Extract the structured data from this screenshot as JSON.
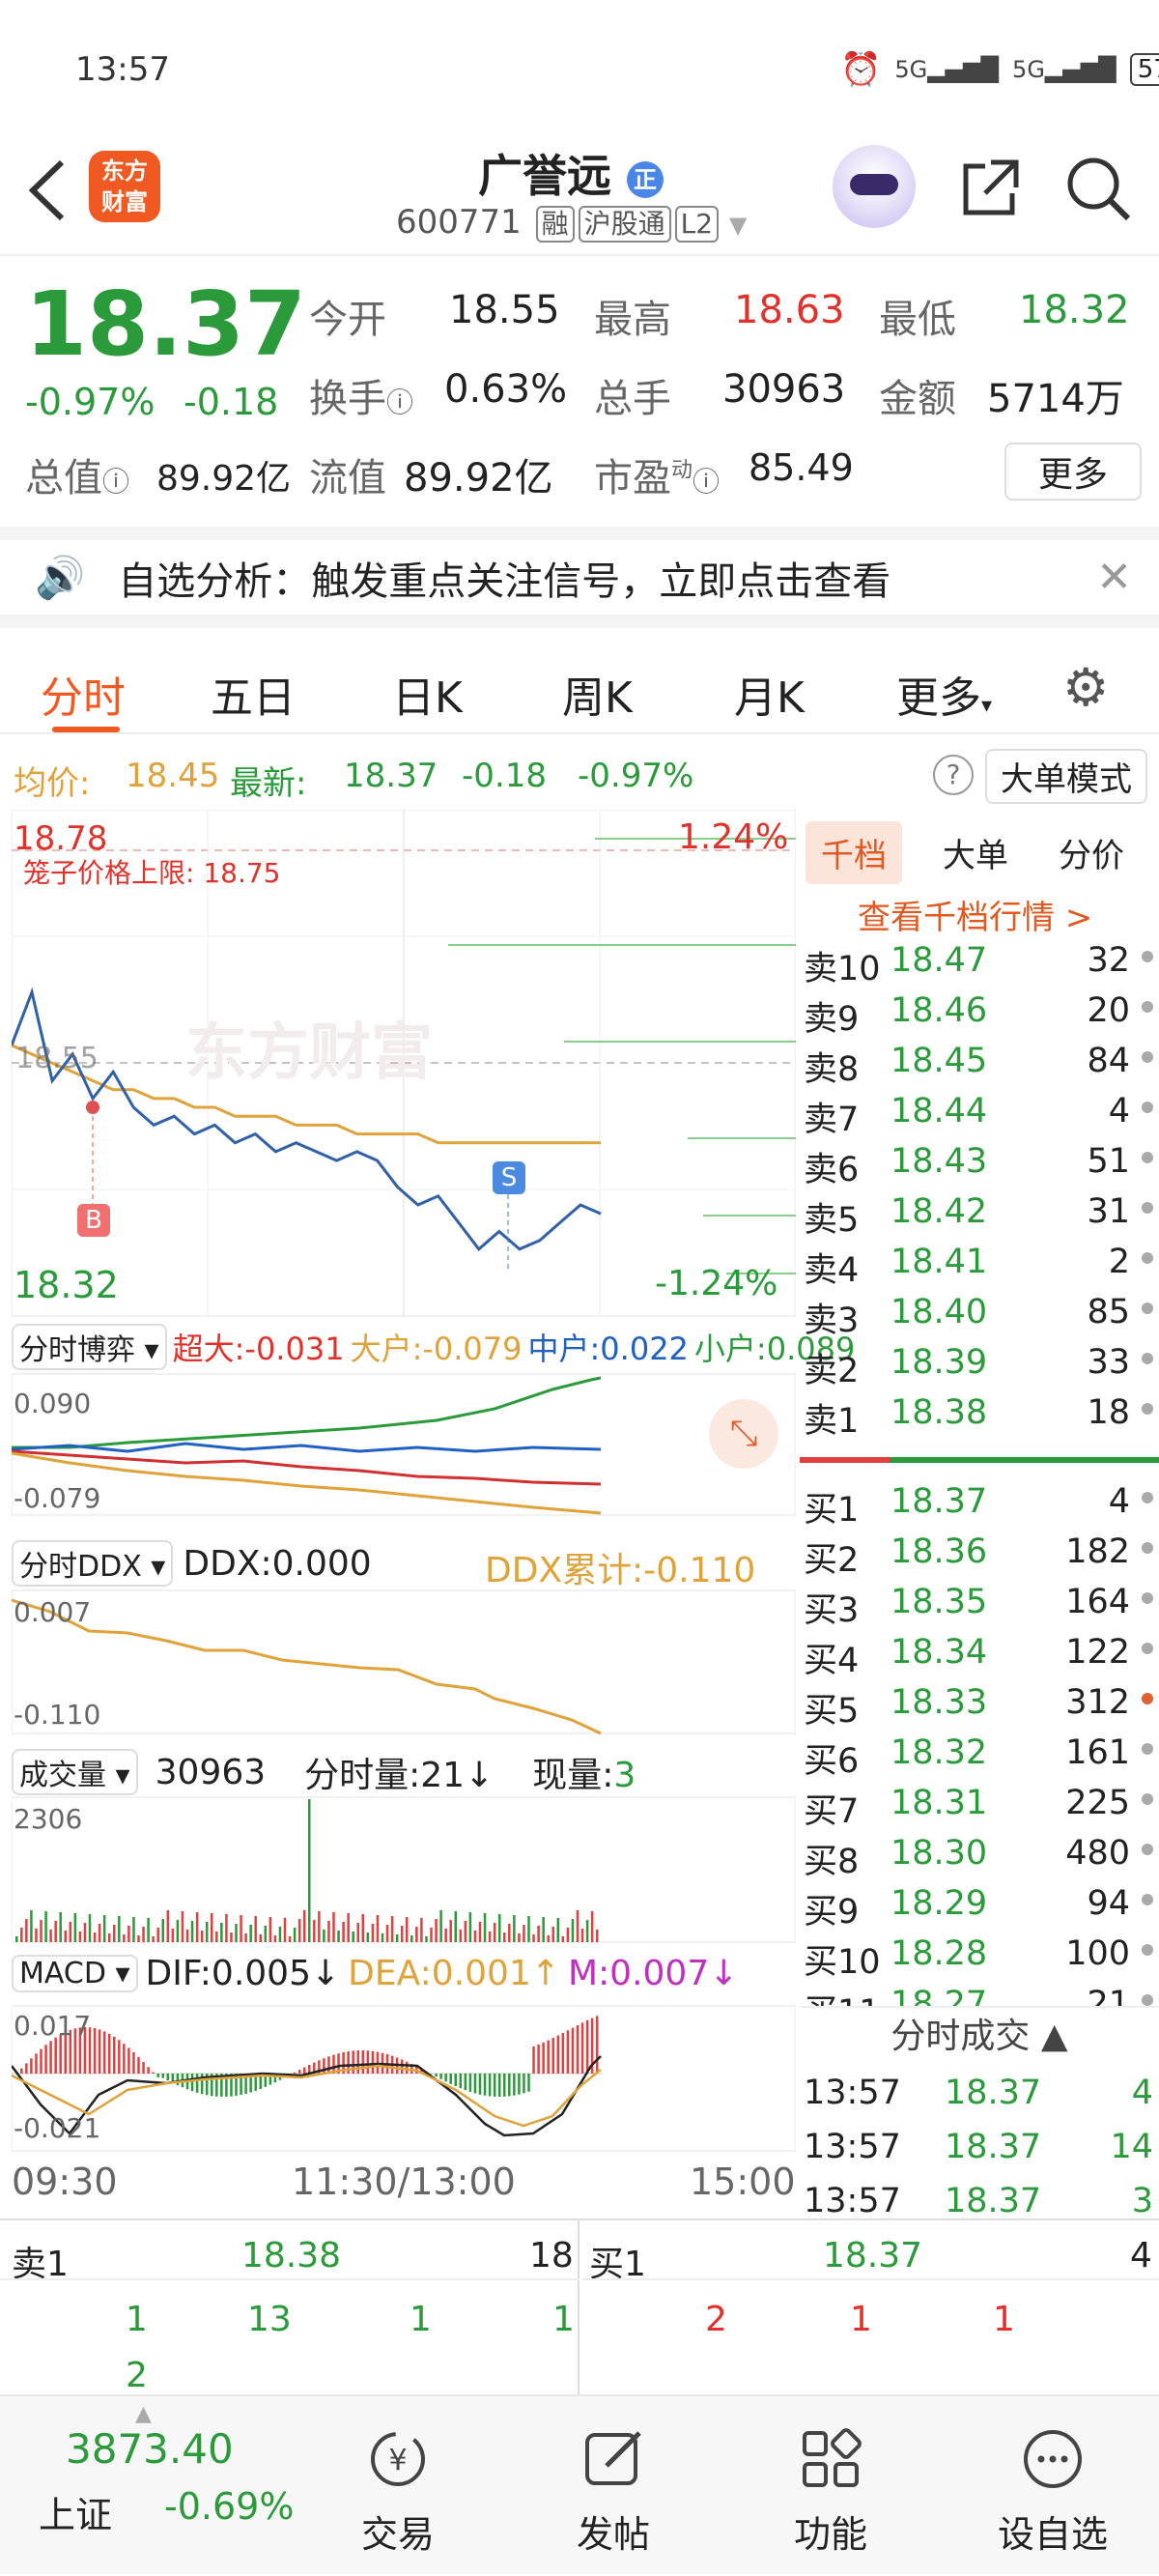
{
  "status": {
    "time": "13:57",
    "battery": "57"
  },
  "header": {
    "title": "广誉远",
    "badge": "正",
    "code": "600771",
    "tags": [
      "融",
      "沪股通",
      "L2"
    ],
    "logo_text_1": "东方",
    "logo_text_2": "财富"
  },
  "quote": {
    "price": "18.37",
    "change_pct": "-0.97%",
    "change": "-0.18",
    "open_label": "今开",
    "open": "18.55",
    "high_label": "最高",
    "high": "18.63",
    "low_label": "最低",
    "low": "18.32",
    "turnover_label": "换手",
    "turnover": "0.63%",
    "volume_label": "总手",
    "volume": "30963",
    "amount_label": "金额",
    "amount": "5714万",
    "mcap_label": "总值",
    "mcap": "89.92亿",
    "float_label": "流值",
    "float_mcap": "89.92亿",
    "pe_label": "市盈",
    "pe_sup": "动",
    "pe": "85.49",
    "more": "更多"
  },
  "notice": {
    "text": "自选分析：触发重点关注信号，立即点击查看"
  },
  "tabs": [
    "分时",
    "五日",
    "日K",
    "周K",
    "月K",
    "更多"
  ],
  "avg_line": {
    "avg_label": "均价:",
    "avg": "18.45",
    "latest_label": "最新:",
    "latest": "18.37",
    "chg": "-0.18",
    "pct": "-0.97%",
    "mode_button": "大单模式"
  },
  "chart": {
    "top_price": "18.78",
    "top_pct": "1.24%",
    "limit_label": "笼子价格上限: 18.75",
    "prev_close": "18.55",
    "bottom_price": "18.32",
    "bottom_pct": "-1.24%",
    "watermark": "东方财富",
    "buy_mark": "B",
    "sell_mark": "S",
    "flow_selector": "分时博弈",
    "flow_super": "超大:-0.031",
    "flow_big": "大户:-0.079",
    "flow_mid": "中户:0.022",
    "flow_small": "小户:0.089",
    "flow_max": "0.090",
    "flow_min": "-0.079",
    "ddx_selector": "分时DDX",
    "ddx": "DDX:0.000",
    "ddx_cum": "DDX累计:-0.110",
    "ddx_max": "0.007",
    "ddx_min": "-0.110",
    "vol_selector": "成交量",
    "vol_total": "30963",
    "vol_min_label": "分时量:21↓",
    "vol_now_label": "现量:",
    "vol_now": "3",
    "vol_max": "2306",
    "macd_selector": "MACD",
    "dif": "DIF:0.005↓",
    "dea": "DEA:0.001↑",
    "m": "M:0.007↓",
    "macd_max": "0.017",
    "macd_min": "-0.021",
    "time_start": "09:30",
    "time_mid": "11:30/13:00",
    "time_end": "15:00"
  },
  "chart_data": {
    "type": "line",
    "x_labels": [
      "09:30",
      "11:30/13:00",
      "15:00"
    ],
    "ylim": [
      18.32,
      18.78
    ],
    "prev_close": 18.55,
    "series": [
      {
        "name": "price",
        "values": [
          18.56,
          18.62,
          18.52,
          18.55,
          18.5,
          18.53,
          18.49,
          18.47,
          18.48,
          18.46,
          18.47,
          18.45,
          18.46,
          18.44,
          18.45,
          18.44,
          18.43,
          18.44,
          18.43,
          18.4,
          18.38,
          18.39,
          18.36,
          18.33,
          18.35,
          18.33,
          18.34,
          18.36,
          18.38,
          18.37
        ]
      },
      {
        "name": "avg",
        "values": [
          18.56,
          18.55,
          18.54,
          18.53,
          18.52,
          18.51,
          18.51,
          18.5,
          18.5,
          18.49,
          18.49,
          18.48,
          18.48,
          18.48,
          18.47,
          18.47,
          18.47,
          18.46,
          18.46,
          18.46,
          18.46,
          18.45,
          18.45,
          18.45,
          18.45,
          18.45,
          18.45,
          18.45,
          18.45,
          18.45
        ]
      }
    ]
  },
  "depth": {
    "tabs": [
      "千档",
      "大单",
      "分价"
    ],
    "link": "查看千档行情 >",
    "asks": [
      [
        "卖10",
        "18.47",
        "32"
      ],
      [
        "卖9",
        "18.46",
        "20"
      ],
      [
        "卖8",
        "18.45",
        "84"
      ],
      [
        "卖7",
        "18.44",
        "4"
      ],
      [
        "卖6",
        "18.43",
        "51"
      ],
      [
        "卖5",
        "18.42",
        "31"
      ],
      [
        "卖4",
        "18.41",
        "2"
      ],
      [
        "卖3",
        "18.40",
        "85"
      ],
      [
        "卖2",
        "18.39",
        "33"
      ],
      [
        "卖1",
        "18.38",
        "18"
      ]
    ],
    "bids": [
      [
        "买1",
        "18.37",
        "4"
      ],
      [
        "买2",
        "18.36",
        "182"
      ],
      [
        "买3",
        "18.35",
        "164"
      ],
      [
        "买4",
        "18.34",
        "122"
      ],
      [
        "买5",
        "18.33",
        "312"
      ],
      [
        "买6",
        "18.32",
        "161"
      ],
      [
        "买7",
        "18.31",
        "225"
      ],
      [
        "买8",
        "18.30",
        "480"
      ],
      [
        "买9",
        "18.29",
        "94"
      ],
      [
        "买10",
        "18.28",
        "100"
      ],
      [
        "买11",
        "18.27",
        "21"
      ]
    ],
    "trades_header": "分时成交",
    "trades": [
      [
        "13:57",
        "18.37",
        "4"
      ],
      [
        "13:57",
        "18.37",
        "14"
      ],
      [
        "13:57",
        "18.37",
        "3"
      ]
    ]
  },
  "bottom": {
    "ask_label": "卖1",
    "ask_price": "18.38",
    "ask_vol": "18",
    "bid_label": "买1",
    "bid_price": "18.37",
    "bid_vol": "4",
    "ask_queue": [
      "1",
      "13",
      "1",
      "1",
      "2"
    ],
    "bid_queue": [
      "2",
      "1",
      "1"
    ]
  },
  "nav": {
    "index_value": "3873.40",
    "index_name": "上证",
    "index_pct": "-0.69%",
    "items": [
      "交易",
      "发帖",
      "功能",
      "设自选"
    ]
  }
}
